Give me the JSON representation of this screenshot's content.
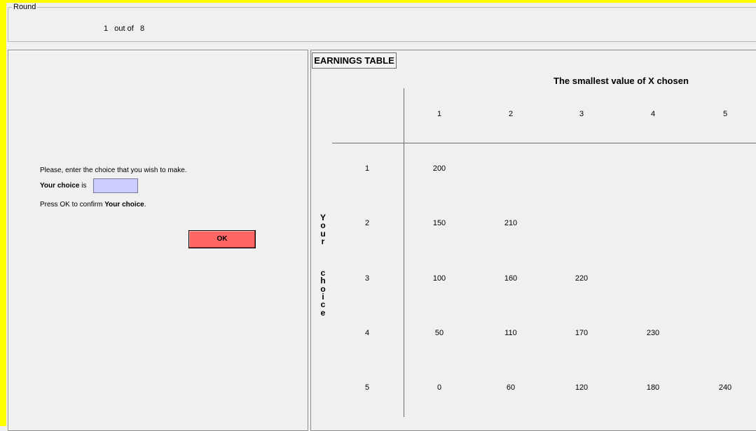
{
  "round": {
    "legend": "Round",
    "text": "1   out of   8"
  },
  "form": {
    "prompt": "Please, enter the choice that you wish to make.",
    "choice_label_bold": "Your choice",
    "choice_label_rest": " is",
    "choice_value": "",
    "confirm_prefix": "Press OK to confirm ",
    "confirm_bold": "Your choice",
    "confirm_suffix": ".",
    "ok_label": "OK",
    "ok_color": "#ff6666",
    "input_color": "#ccccff"
  },
  "earnings": {
    "tab_label": "EARNINGS TABLE",
    "title": "The smallest value of X chosen",
    "side_label": "Your choice",
    "columns": [
      "1",
      "2",
      "3",
      "4",
      "5"
    ],
    "rows": [
      {
        "label": "1",
        "values": [
          "200",
          "",
          "",
          "",
          ""
        ]
      },
      {
        "label": "2",
        "values": [
          "150",
          "210",
          "",
          "",
          ""
        ]
      },
      {
        "label": "3",
        "values": [
          "100",
          "160",
          "220",
          "",
          ""
        ]
      },
      {
        "label": "4",
        "values": [
          "50",
          "110",
          "170",
          "230",
          ""
        ]
      },
      {
        "label": "5",
        "values": [
          "0",
          "60",
          "120",
          "180",
          "240"
        ]
      }
    ]
  },
  "colors": {
    "frame": "#ffff00",
    "background": "#f0f0f0"
  }
}
